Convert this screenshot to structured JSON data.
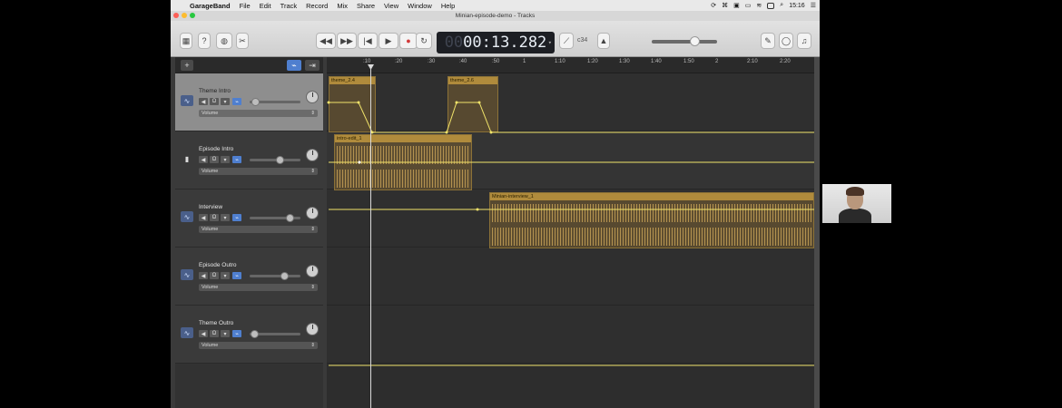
{
  "menubar": {
    "app_name": "GarageBand",
    "items": [
      "File",
      "Edit",
      "Track",
      "Record",
      "Mix",
      "Share",
      "View",
      "Window",
      "Help"
    ],
    "clock": "15:16"
  },
  "window": {
    "title": "Minian-episode-demo - Tracks"
  },
  "transport": {
    "time_dim": "00",
    "time": "00:13.282",
    "key": "c34"
  },
  "ruler": {
    "ticks": [
      ":10",
      ":20",
      ":30",
      ":40",
      ":50",
      "1",
      "1:10",
      "1:20",
      "1:30",
      "1:40",
      "1:50",
      "2",
      "2:10",
      "2:20"
    ]
  },
  "tracks": [
    {
      "name": "Theme Intro",
      "automation": "Volume",
      "volume": 0.05,
      "selected": true
    },
    {
      "name": "Episode Intro",
      "automation": "Volume",
      "volume": 0.62,
      "selected": false
    },
    {
      "name": "Interview",
      "automation": "Volume",
      "volume": 0.85,
      "selected": false
    },
    {
      "name": "Episode Outro",
      "automation": "Volume",
      "volume": 0.72,
      "selected": false
    },
    {
      "name": "Theme Outro",
      "automation": "Volume",
      "volume": 0.02,
      "selected": false
    }
  ],
  "regions": [
    {
      "label": "theme_2.4",
      "track": 0
    },
    {
      "label": "theme_2.6",
      "track": 0
    },
    {
      "label": "intro-edit_1",
      "track": 1
    },
    {
      "label": "Minian-interview_1",
      "track": 2
    }
  ],
  "colors": {
    "region_header": "#b08b3c",
    "automation_line": "#f0e36a",
    "lcd_bg": "#1d1f24"
  }
}
